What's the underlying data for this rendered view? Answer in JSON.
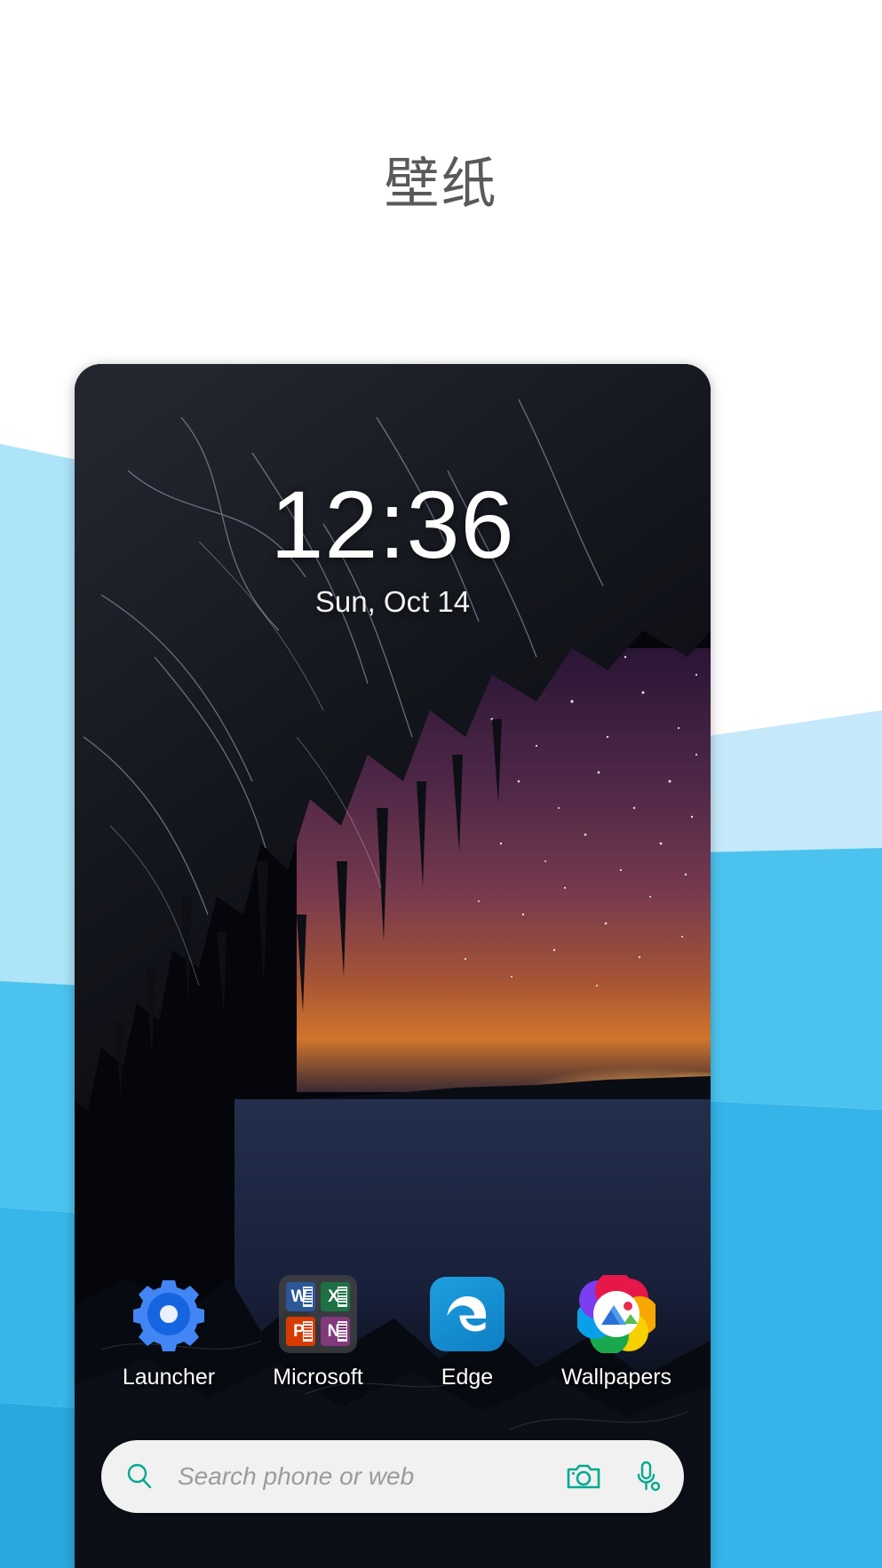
{
  "page": {
    "title": "壁纸",
    "title_color": "#595959",
    "background": "#ffffff"
  },
  "decor": {
    "light_blue": "#ade4f8",
    "mid_blue": "#4cc3ef",
    "blue": "#37b6ea",
    "deep_blue": "#29a8e0"
  },
  "phone": {
    "lockscreen": {
      "time": "12:36",
      "date": "Sun, Oct 14",
      "time_color": "#ffffff",
      "date_color": "#f2f2f2"
    },
    "dock": {
      "apps": [
        {
          "label": "Launcher",
          "icon": "gear-icon",
          "color": "#4285f4"
        },
        {
          "label": "Microsoft",
          "icon": "office-folder-icon",
          "color": "#464646"
        },
        {
          "label": "Edge",
          "icon": "edge-icon",
          "color": "#1b9de2"
        },
        {
          "label": "Wallpapers",
          "icon": "wallpapers-icon",
          "color": "#4a8bf5"
        }
      ],
      "office_tiles": [
        {
          "name": "word-icon",
          "glyph": "W",
          "color": "#2b5797"
        },
        {
          "name": "excel-icon",
          "glyph": "X",
          "color": "#1e7145"
        },
        {
          "name": "powerpoint-icon",
          "glyph": "P",
          "color": "#d83b01"
        },
        {
          "name": "onenote-icon",
          "glyph": "N",
          "color": "#80397b"
        }
      ]
    },
    "search": {
      "placeholder": "Search phone or web",
      "icon_color": "#00a98f",
      "bar_color": "#f1f1f1",
      "search_icon": "search-icon",
      "camera_icon": "camera-icon",
      "mic_icon": "microphone-icon"
    }
  }
}
